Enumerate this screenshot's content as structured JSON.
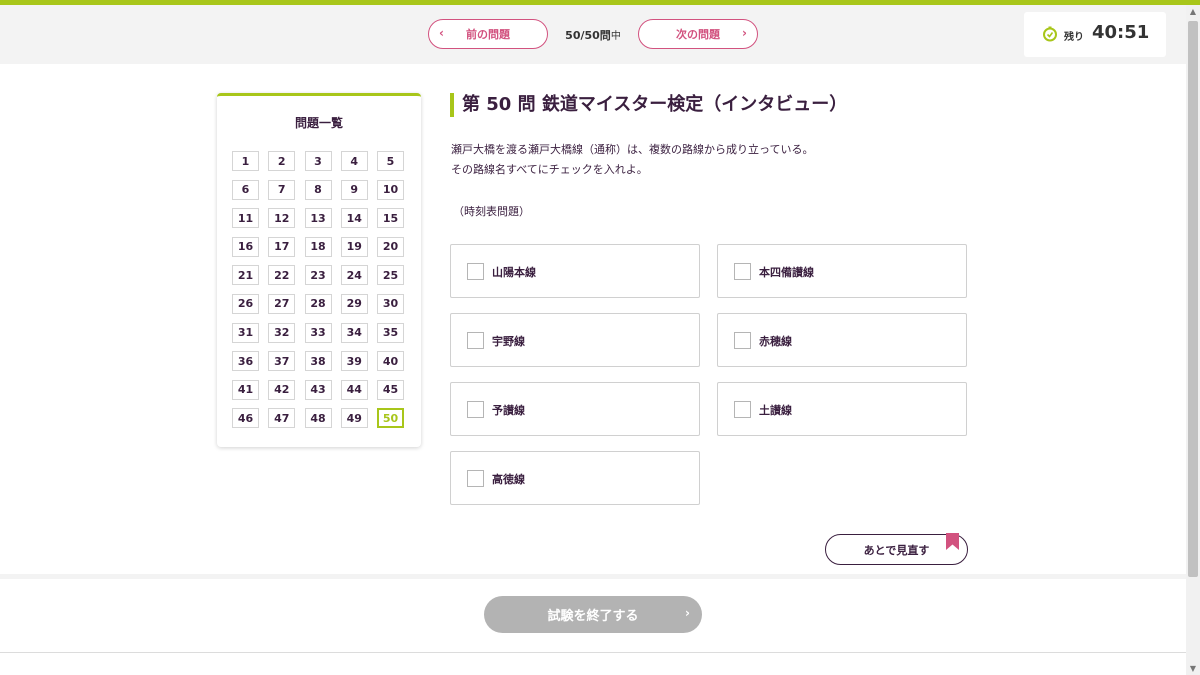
{
  "header": {
    "prev_label": "前の問題",
    "next_label": "次の問題",
    "progress": "50/50問",
    "progress_suffix": "中",
    "timer_label": "残り",
    "timer_value": "40:51"
  },
  "question_list": {
    "title": "問題一覧",
    "numbers": [
      "1",
      "2",
      "3",
      "4",
      "5",
      "6",
      "7",
      "8",
      "9",
      "10",
      "11",
      "12",
      "13",
      "14",
      "15",
      "16",
      "17",
      "18",
      "19",
      "20",
      "21",
      "22",
      "23",
      "24",
      "25",
      "26",
      "27",
      "28",
      "29",
      "30",
      "31",
      "32",
      "33",
      "34",
      "35",
      "36",
      "37",
      "38",
      "39",
      "40",
      "41",
      "42",
      "43",
      "44",
      "45",
      "46",
      "47",
      "48",
      "49",
      "50"
    ],
    "current": "50"
  },
  "question": {
    "title": "第 50 問 鉄道マイスター検定（インタビュー）",
    "line1": "瀬戸大橋を渡る瀬戸大橋線（通称）は、複数の路線から成り立っている。",
    "line2": "その路線名すべてにチェックを入れよ。",
    "note": "（時刻表問題）",
    "options": [
      "山陽本線",
      "本四備讃線",
      "宇野線",
      "赤穂線",
      "予讃線",
      "土讃線",
      "高徳線"
    ]
  },
  "actions": {
    "later_label": "あとで見直す",
    "finish_label": "試験を終了する"
  },
  "colors": {
    "accent_green": "#a8c61a",
    "accent_pink": "#d2527f",
    "text_dark": "#3a1f3f",
    "finish_disabled": "#b3b3b3"
  },
  "icons": [
    "chevron-left-icon",
    "chevron-right-icon",
    "clock-icon",
    "checkbox-icon",
    "bookmark-icon"
  ]
}
